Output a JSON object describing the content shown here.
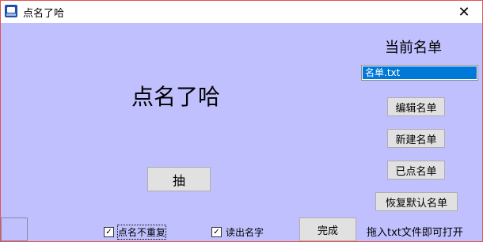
{
  "window": {
    "title": "点名了哈",
    "close_glyph": "✕"
  },
  "main": {
    "display_name": "点名了哈",
    "draw_label": "抽"
  },
  "roster": {
    "header": "当前名单",
    "files": [
      "名单.txt"
    ],
    "edit_label": "编辑名单",
    "new_label": "新建名单",
    "called_label": "已点名单",
    "restore_label": "恢复默认名单"
  },
  "options": {
    "no_repeat_label": "点名不重复",
    "no_repeat_checked": true,
    "read_name_label": "读出名字",
    "read_name_checked": true,
    "check_glyph": "✓"
  },
  "footer": {
    "done_label": "完成",
    "drop_hint": "拖入txt文件即可打开"
  },
  "colors": {
    "client_bg": "#c0c0ff",
    "selection": "#0078d7",
    "border": "#e35454"
  }
}
